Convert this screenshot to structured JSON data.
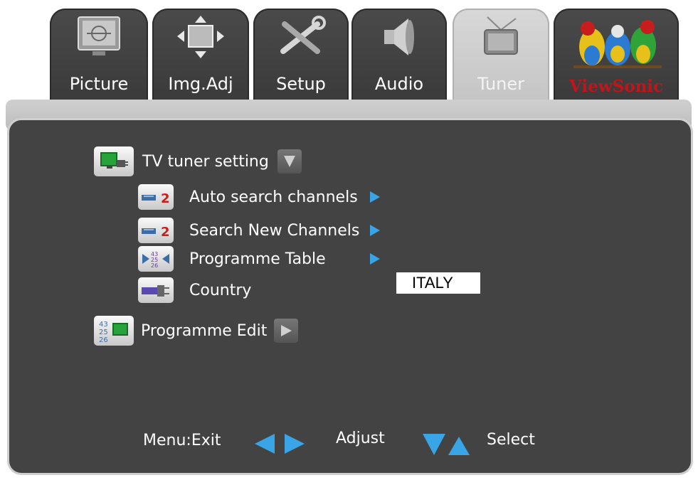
{
  "tabs": [
    {
      "label": "Picture",
      "icon": "monitor-icon",
      "active": false
    },
    {
      "label": "Img.Adj",
      "icon": "move-arrows-icon",
      "active": false
    },
    {
      "label": "Setup",
      "icon": "tools-icon",
      "active": false
    },
    {
      "label": "Audio",
      "icon": "speaker-icon",
      "active": false
    },
    {
      "label": "Tuner",
      "icon": "tv-antenna-icon",
      "active": true
    }
  ],
  "brand": {
    "logo_text": "ViewSonic",
    "icon": "viewsonic-birds-logo"
  },
  "menu": {
    "heading": {
      "label": "TV tuner setting",
      "icon": "tv-plug-icon",
      "indicator": "triangle-down-icon"
    },
    "items": [
      {
        "label": "Auto search channels",
        "icon": "channel-search-icon",
        "indicator": "arrow-right-icon"
      },
      {
        "label": "Search New Channels",
        "icon": "channel-search-icon",
        "indicator": "arrow-right-icon"
      },
      {
        "label": "Programme Table",
        "icon": "programme-table-icon",
        "indicator": "arrow-right-icon"
      },
      {
        "label": "Country",
        "icon": "plug-icon",
        "value": "ITALY"
      }
    ],
    "edit": {
      "label": "Programme Edit",
      "icon": "programme-edit-icon",
      "indicator": "triangle-right-icon"
    }
  },
  "footer": {
    "exit_label": "Menu:Exit",
    "adjust_label": "Adjust",
    "select_label": "Select",
    "adjust_icon": "left-right-arrows-icon",
    "select_icon": "down-up-arrows-icon"
  },
  "colors": {
    "panel": "#434343",
    "accent_blue": "#39a4e6",
    "tab_active": "#c8c8c8",
    "brand_red": "#c0161b"
  }
}
